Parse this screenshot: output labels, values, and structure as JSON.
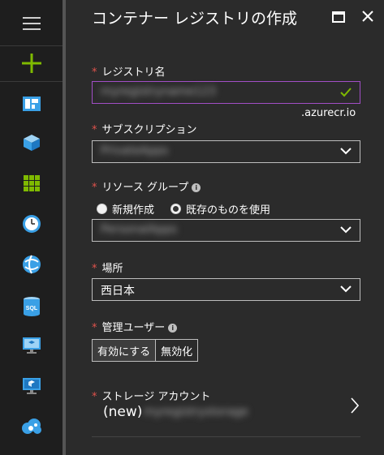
{
  "rail": {
    "items": [
      {
        "icon": "menu-icon"
      },
      {
        "icon": "plus-icon"
      },
      {
        "icon": "dashboard-icon"
      },
      {
        "icon": "cube-icon"
      },
      {
        "icon": "grid-icon"
      },
      {
        "icon": "clock-icon"
      },
      {
        "icon": "globe-icon"
      },
      {
        "icon": "sql-icon"
      },
      {
        "icon": "vm-icon"
      },
      {
        "icon": "monitor-cube-icon"
      },
      {
        "icon": "cloud-gear-icon"
      }
    ],
    "sql_text": "SQL"
  },
  "blade": {
    "title": "コンテナー レジストリの作成",
    "registry_name": {
      "required": "*",
      "label": "レジストリ名",
      "value": "myregistryname123",
      "suffix": ".azurecr.io"
    },
    "subscription": {
      "required": "*",
      "label": "サブスクリプション",
      "value": "PrivateApps"
    },
    "resource_group": {
      "required": "*",
      "label": "リソース グループ",
      "info": "i",
      "option_new": "新規作成",
      "option_existing": "既存のものを使用",
      "selected": "existing",
      "value": "PersonalApps"
    },
    "location": {
      "required": "*",
      "label": "場所",
      "value": "西日本"
    },
    "admin_user": {
      "required": "*",
      "label": "管理ユーザー",
      "info": "i",
      "enable": "有効にする",
      "disable": "無効化",
      "selected": "enable"
    },
    "storage": {
      "required": "*",
      "label": "ストレージ アカウント",
      "prefix": "(new)",
      "value": "myregistrystorage"
    }
  },
  "colors": {
    "required": "#e0524c",
    "accent_green": "#7fba00",
    "valid_border": "#a24ec6"
  }
}
